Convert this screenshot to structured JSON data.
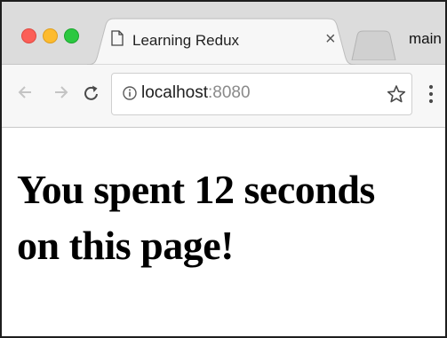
{
  "tab": {
    "title": "Learning Redux",
    "close_glyph": "×"
  },
  "profile": {
    "label": "main"
  },
  "omnibox": {
    "host": "localhost",
    "port": ":8080"
  },
  "icons": {
    "back": "back-arrow-icon",
    "forward": "forward-arrow-icon",
    "reload": "reload-icon",
    "info": "info-icon",
    "star": "bookmark-star-icon",
    "menu": "kebab-menu-icon",
    "page": "document-icon"
  },
  "colors": {
    "close": "#fc5f57",
    "minimize": "#fdbb2e",
    "maximize": "#2bc840"
  },
  "page": {
    "message": "You spent 12 seconds on this page!"
  }
}
